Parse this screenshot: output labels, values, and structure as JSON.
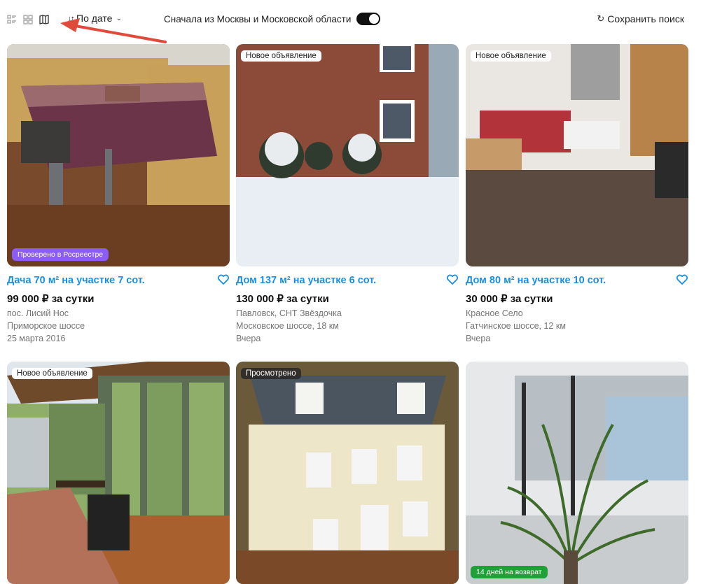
{
  "toolbar": {
    "view_icons": [
      "list-view-icon",
      "grid-view-icon",
      "map-view-icon"
    ],
    "sort_label": "По дате",
    "region_label": "Сначала из Москвы и Московской области",
    "region_toggle_on": true,
    "save_label": "Сохранить поиск"
  },
  "colors": {
    "accent": "#1a8fe0",
    "verified": "#8b5cf6",
    "return_badge": "#21a038",
    "arrow": "#e04a3a"
  },
  "listings": [
    {
      "badge": "",
      "bottom_badge": "Проверено в Росреестре",
      "title": "Дача 70 м² на участке 7 сот.",
      "price": "99 000 ₽ за сутки",
      "line1": "пос. Лисий Нос",
      "line2": "Приморское шоссе",
      "line3": "25 марта 2016"
    },
    {
      "badge": "Новое объявление",
      "bottom_badge": "",
      "title": "Дом 137 м² на участке 6 сот.",
      "price": "130 000 ₽ за сутки",
      "line1": "Павловск, СНТ Звёздочка",
      "line2": "Московское шоссе, 18 км",
      "line3": "Вчера"
    },
    {
      "badge": "Новое объявление",
      "bottom_badge": "",
      "title": "Дом 80 м² на участке 10 сот.",
      "price": "30 000 ₽ за сутки",
      "line1": "Красное Село",
      "line2": "Гатчинское шоссе, 12 км",
      "line3": "Вчера"
    },
    {
      "badge": "Новое объявление",
      "bottom_badge": ""
    },
    {
      "badge": "Просмотрено",
      "bottom_badge": ""
    },
    {
      "badge": "",
      "bottom_badge": "14 дней на возврат"
    }
  ]
}
